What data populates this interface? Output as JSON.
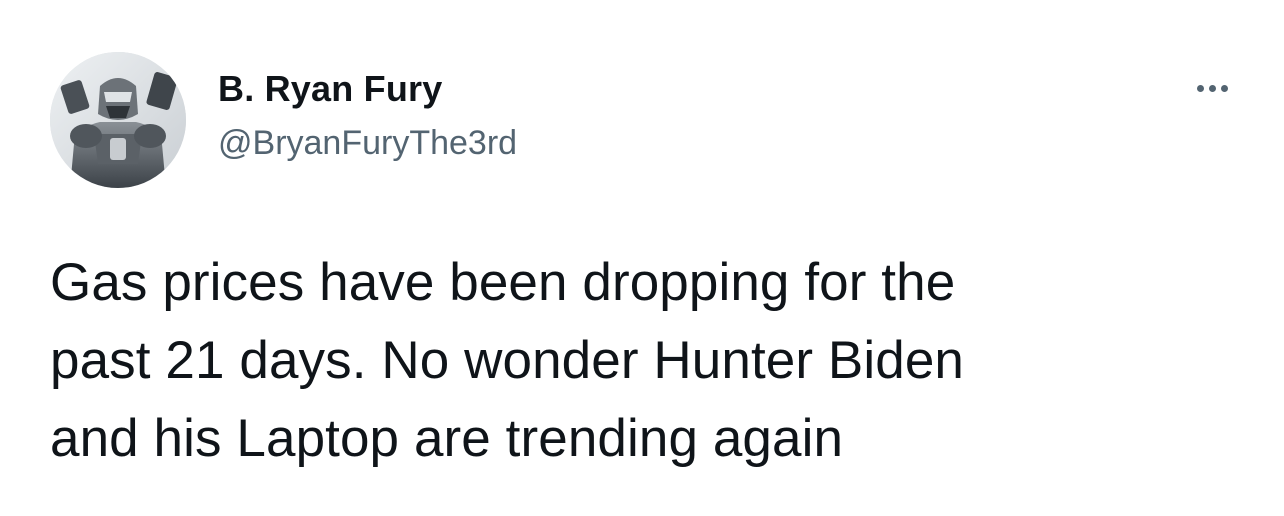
{
  "author": {
    "display_name": "B. Ryan Fury",
    "handle": "@BryanFuryThe3rd",
    "avatar_icon": "armored-robot-avatar"
  },
  "menu": {
    "icon": "more-horizontal-icon"
  },
  "tweet": {
    "text": "Gas prices have been dropping for the\npast 21 days. No wonder Hunter Biden\nand his Laptop are trending again"
  },
  "colors": {
    "text_primary": "#0f1419",
    "text_secondary": "#536471",
    "background": "#ffffff"
  }
}
